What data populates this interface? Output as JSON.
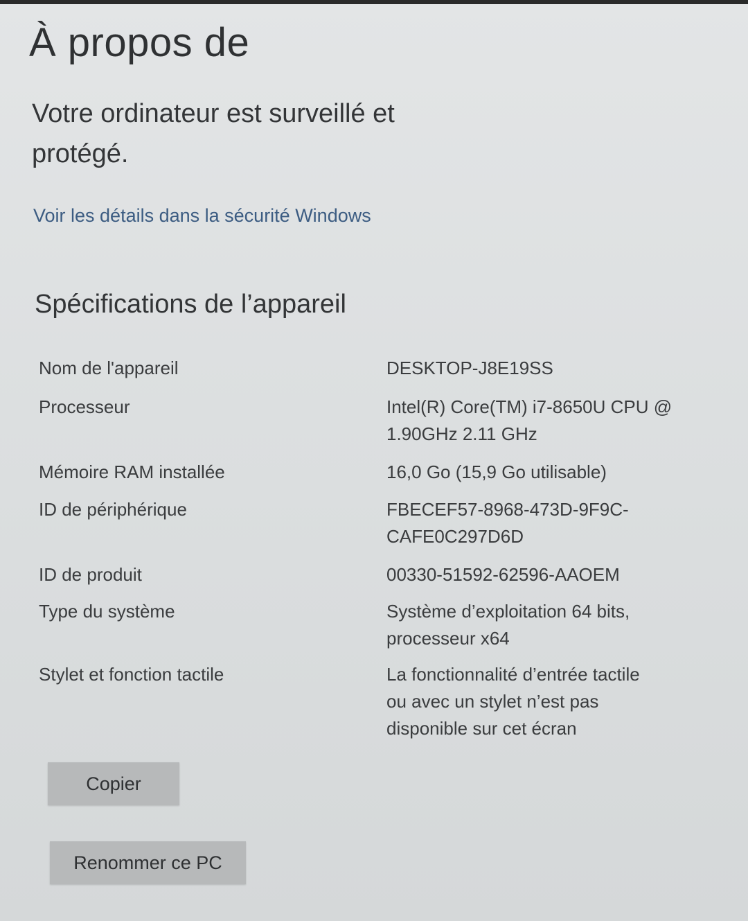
{
  "page": {
    "title": "À propos de"
  },
  "security": {
    "status": "Votre ordinateur est surveillé et protégé.",
    "link_label": "Voir les détails dans la sécurité Windows"
  },
  "device_specs": {
    "title": "Spécifications de l’appareil",
    "rows": [
      {
        "label": "Nom de l'appareil",
        "value": "DESKTOP-J8E19SS"
      },
      {
        "label": "Processeur",
        "value": "Intel(R) Core(TM) i7-8650U CPU @\n1.90GHz   2.11 GHz"
      },
      {
        "label": "Mémoire RAM installée",
        "value": "16,0 Go (15,9 Go utilisable)"
      },
      {
        "label": "ID de périphérique",
        "value": "FBECEF57-8968-473D-9F9C-\nCAFE0C297D6D"
      },
      {
        "label": "ID de produit",
        "value": "00330-51592-62596-AAOEM"
      },
      {
        "label": "Type du système",
        "value": "Système d’exploitation 64 bits,\nprocesseur x64"
      },
      {
        "label": "Stylet et fonction tactile",
        "value": "La fonctionnalité d’entrée tactile\nou avec un stylet n’est pas\ndisponible sur cet écran"
      }
    ]
  },
  "actions": {
    "copy_label": "Copier",
    "rename_label": "Renommer ce PC"
  },
  "colors": {
    "background": "#dcdfe0",
    "link": "#3c5c82",
    "button": "#b7b9ba"
  }
}
